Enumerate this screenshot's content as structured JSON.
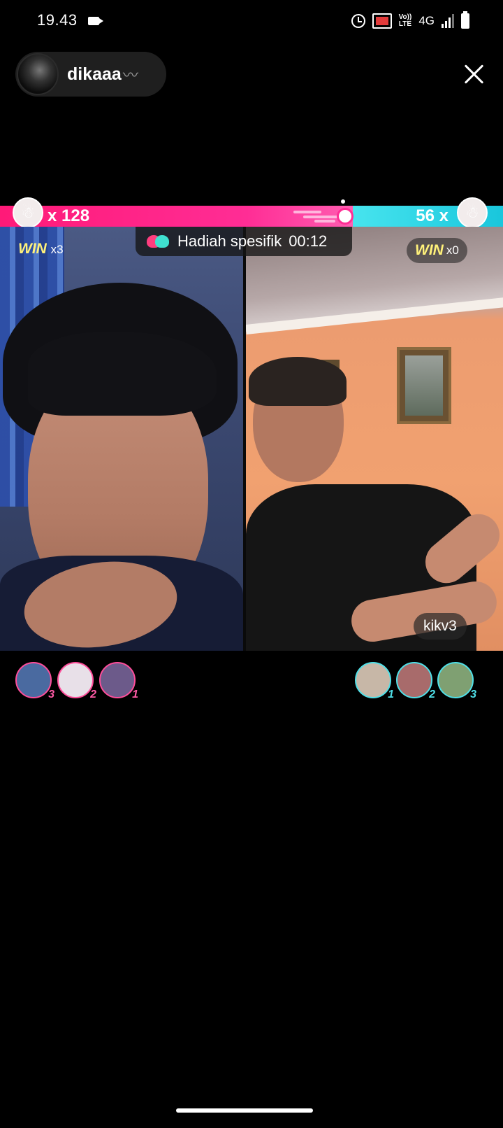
{
  "status_bar": {
    "time": "19.43",
    "volte_top": "Vo))",
    "volte_bottom": "LTE",
    "network": "4G"
  },
  "host": {
    "name": "dikaaa",
    "decoration": "〰"
  },
  "battle": {
    "left_score_label": "x 128",
    "right_score_label": "56 x",
    "left_score": 128,
    "right_score": 56,
    "left_color": "#ff2d95",
    "right_color": "#2fd3e6",
    "gift_label": "Hadiah spesifik",
    "gift_timer": "00:12",
    "win_word": "WIN",
    "left_wins": "x3",
    "right_wins": "x0",
    "opponent_name": "kikv3"
  },
  "supporters": {
    "left": [
      {
        "rank": "3",
        "color": "#4a6aa0"
      },
      {
        "rank": "2",
        "color": "#e8e0e8"
      },
      {
        "rank": "1",
        "color": "#6c5a8a"
      }
    ],
    "right": [
      {
        "rank": "1",
        "color": "#c7b7a7"
      },
      {
        "rank": "2",
        "color": "#a86b6b"
      },
      {
        "rank": "3",
        "color": "#7fa072"
      }
    ]
  }
}
